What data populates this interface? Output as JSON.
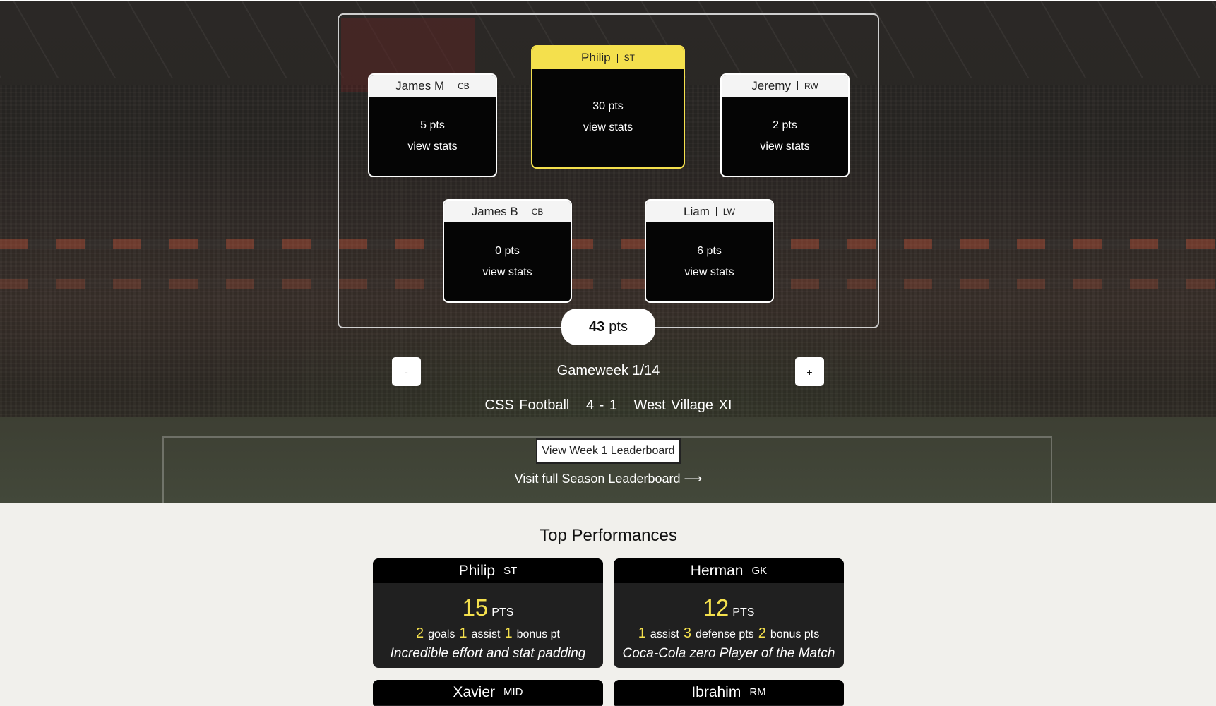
{
  "formation": {
    "players": [
      {
        "name": "James M",
        "pos": "CB",
        "pts": "5 pts",
        "link": "view stats"
      },
      {
        "name": "Philip",
        "pos": "ST",
        "pts": "30 pts",
        "link": "view stats"
      },
      {
        "name": "Jeremy",
        "pos": "RW",
        "pts": "2 pts",
        "link": "view stats"
      },
      {
        "name": "James B",
        "pos": "CB",
        "pts": "0 pts",
        "link": "view stats"
      },
      {
        "name": "Liam",
        "pos": "LW",
        "pts": "6 pts",
        "link": "view stats"
      }
    ],
    "total_value": "43",
    "total_unit": "pts"
  },
  "gameweek": {
    "minus_label": "-",
    "plus_label": "+",
    "label": "Gameweek 1/14"
  },
  "match": {
    "home": "CSS Football",
    "score": "4 - 1",
    "away": "West Village XI"
  },
  "links": {
    "week_leaderboard": "View Week 1 Leaderboard",
    "season_leaderboard": "Visit full Season Leaderboard ⟶"
  },
  "top_performances": {
    "title": "Top Performances",
    "cards": [
      {
        "name": "Philip",
        "pos": "ST",
        "pts": "15",
        "pts_unit": "PTS",
        "stats": [
          {
            "n": "2",
            "label": "goals"
          },
          {
            "n": "1",
            "label": "assist"
          },
          {
            "n": "1",
            "label": "bonus pt"
          }
        ],
        "note": "Incredible effort and stat padding"
      },
      {
        "name": "Herman",
        "pos": "GK",
        "pts": "12",
        "pts_unit": "PTS",
        "stats": [
          {
            "n": "1",
            "label": "assist"
          },
          {
            "n": "3",
            "label": "defense pts"
          },
          {
            "n": "2",
            "label": "bonus pts"
          }
        ],
        "note": "Coca-Cola zero Player of the Match"
      },
      {
        "name": "Xavier",
        "pos": "MID"
      },
      {
        "name": "Ibrahim",
        "pos": "RM"
      }
    ]
  },
  "colors": {
    "captain_accent": "#f4e04d",
    "card_dark": "#050505",
    "page_bg": "#f1f0ec"
  }
}
